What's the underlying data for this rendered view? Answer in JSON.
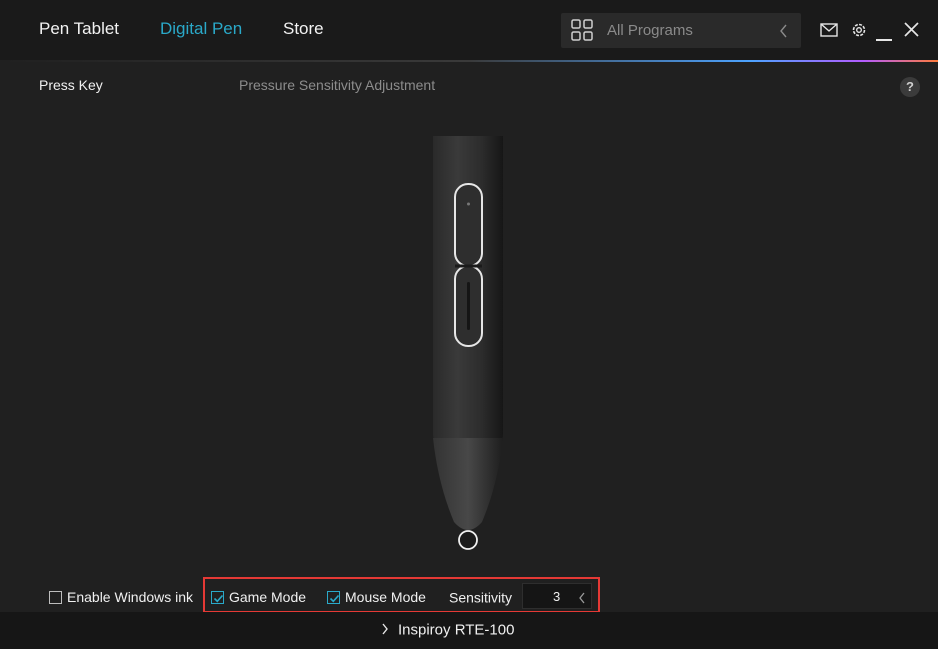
{
  "nav": {
    "tabs": [
      {
        "label": "Pen Tablet",
        "active": false
      },
      {
        "label": "Digital Pen",
        "active": true
      },
      {
        "label": "Store",
        "active": false
      }
    ],
    "program_selector": {
      "label": "All Programs",
      "icon": "grid-icon"
    },
    "icons": [
      "mail-icon",
      "gear-icon",
      "minimize-icon",
      "close-icon"
    ]
  },
  "subtabs": {
    "press_key": "Press Key",
    "pressure": "Pressure Sensitivity Adjustment",
    "help": "?"
  },
  "options": {
    "enable_windows_ink": {
      "label": "Enable Windows ink",
      "checked": false
    },
    "game_mode": {
      "label": "Game Mode",
      "checked": true
    },
    "mouse_mode": {
      "label": "Mouse Mode",
      "checked": true
    },
    "sensitivity": {
      "label": "Sensitivity",
      "value": "3"
    }
  },
  "footer": {
    "device": "Inspiroy RTE-100"
  },
  "colors": {
    "accent": "#2aa9c9",
    "highlight": "#e53935",
    "background": "#202020"
  }
}
